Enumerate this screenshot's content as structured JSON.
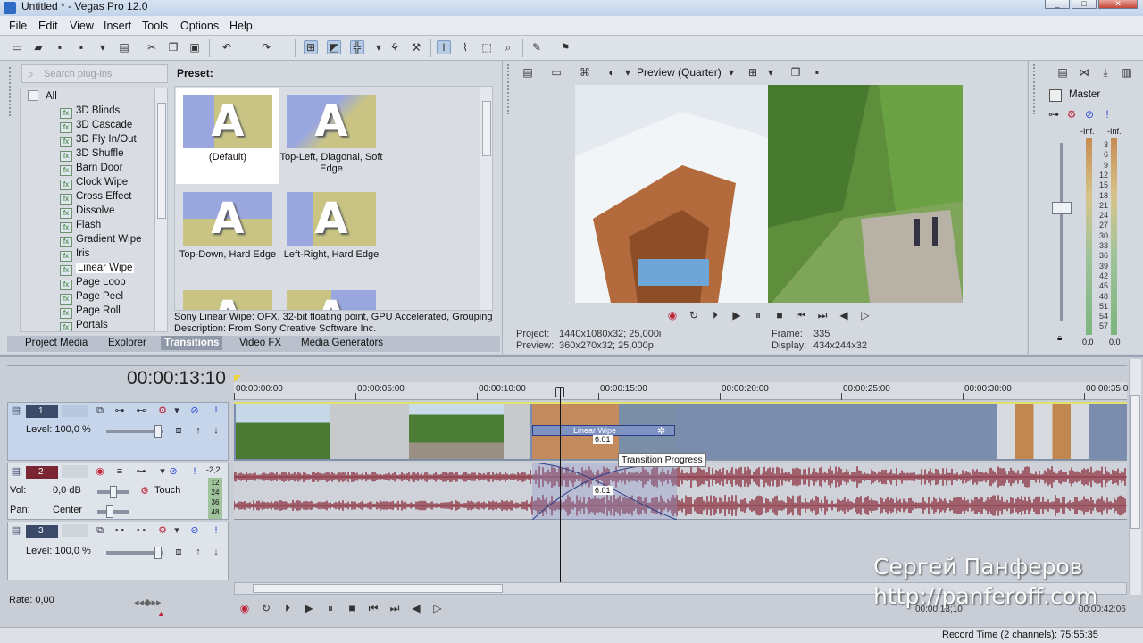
{
  "window": {
    "title": "Untitled * - Vegas Pro 12.0"
  },
  "menu": [
    "File",
    "Edit",
    "View",
    "Insert",
    "Tools",
    "Options",
    "Help"
  ],
  "explorer": {
    "search_placeholder": "Search plug-ins",
    "tree_root": "All",
    "transitions": [
      "3D Blinds",
      "3D Cascade",
      "3D Fly In/Out",
      "3D Shuffle",
      "Barn Door",
      "Clock Wipe",
      "Cross Effect",
      "Dissolve",
      "Flash",
      "Gradient Wipe",
      "Iris",
      "Linear Wipe",
      "Page Loop",
      "Page Peel",
      "Page Roll",
      "Portals"
    ],
    "selected": "Linear Wipe",
    "preset_heading": "Preset:",
    "presets": [
      "(Default)",
      "Top-Left, Diagonal, Soft Edge",
      "Top-Down, Hard Edge",
      "Left-Right, Hard Edge"
    ],
    "description_line1": "Sony Linear Wipe: OFX, 32-bit floating point, GPU Accelerated, Grouping S",
    "description_line2": "Description: From Sony Creative Software Inc.",
    "tabs": [
      "Project Media",
      "Explorer",
      "Transitions",
      "Video FX",
      "Media Generators"
    ],
    "active_tab": "Transitions"
  },
  "preview": {
    "quality": "Preview (Quarter)",
    "project_label": "Project:",
    "project_value": "1440x1080x32; 25,000i",
    "preview_label": "Preview:",
    "preview_value": "360x270x32; 25,000p",
    "frame_label": "Frame:",
    "frame_value": "335",
    "display_label": "Display:",
    "display_value": "434x244x32"
  },
  "master": {
    "label": "Master",
    "peak_left": "-Inf.",
    "peak_right": "-Inf.",
    "db_scale": [
      "3",
      "6",
      "9",
      "12",
      "15",
      "18",
      "21",
      "24",
      "27",
      "30",
      "33",
      "36",
      "39",
      "42",
      "45",
      "48",
      "51",
      "54",
      "57"
    ],
    "bottom_left": "0.0",
    "bottom_right": "0.0"
  },
  "timeline": {
    "timecode": "00:00:13:10",
    "ruler": [
      "00:00:00:00",
      "00:00:05:00",
      "00:00:10:00",
      "00:00:15:00",
      "00:00:20:00",
      "00:00:25:00",
      "00:00:30:00",
      "00:00:35:0"
    ],
    "tracks": [
      {
        "num": "1",
        "level": "Level: 100,0 %"
      },
      {
        "num": "2",
        "vol_label": "Vol:",
        "vol_value": "0,0 dB",
        "touch": "Touch",
        "pan_label": "Pan:",
        "pan_value": "Center",
        "peak": "-2,2",
        "meter_ticks": [
          "12",
          "24",
          "36",
          "48"
        ]
      },
      {
        "num": "3",
        "level": "Level: 100,0 %"
      }
    ],
    "transition_label": "Linear Wipe",
    "transition_duration": "6:01",
    "audio_fade_duration": "6:01",
    "tooltip": "Transition Progress",
    "rate": "Rate: 0,00",
    "bottom_time_left": "00:00:13;10",
    "bottom_time_right": "00:00:42:06"
  },
  "watermark": {
    "line1": "Сергей Панферов",
    "line2": "http://panferoff.com"
  },
  "status": {
    "record_time": "Record Time (2 channels): 75:55:35"
  }
}
